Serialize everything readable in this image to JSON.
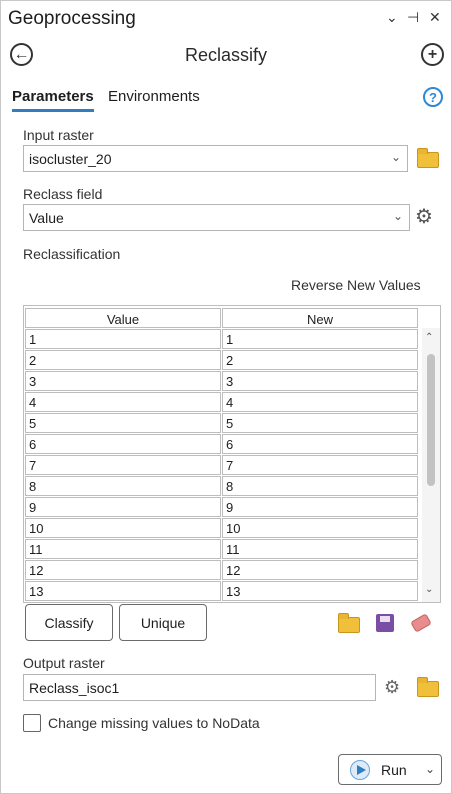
{
  "window": {
    "title": "Geoprocessing",
    "controls": {
      "menu": "⌄",
      "pin": "⊣",
      "close": "✕"
    }
  },
  "header": {
    "tool_name": "Reclassify",
    "back_icon": "←",
    "add_icon": "+"
  },
  "tabs": [
    {
      "label": "Parameters",
      "active": true
    },
    {
      "label": "Environments",
      "active": false
    }
  ],
  "help_icon": "?",
  "input_raster": {
    "label": "Input raster",
    "value": "isocluster_20"
  },
  "reclass_field": {
    "label": "Reclass field",
    "value": "Value"
  },
  "reclassification": {
    "label": "Reclassification",
    "reverse_link": "Reverse New Values",
    "columns": [
      "Value",
      "New"
    ],
    "rows": [
      [
        "1",
        "1"
      ],
      [
        "2",
        "2"
      ],
      [
        "3",
        "3"
      ],
      [
        "4",
        "4"
      ],
      [
        "5",
        "5"
      ],
      [
        "6",
        "6"
      ],
      [
        "7",
        "7"
      ],
      [
        "8",
        "8"
      ],
      [
        "9",
        "9"
      ],
      [
        "10",
        "10"
      ],
      [
        "11",
        "11"
      ],
      [
        "12",
        "12"
      ],
      [
        "13",
        "13"
      ]
    ],
    "scroll_up": "⌃",
    "scroll_down": "⌄"
  },
  "buttons": {
    "classify": "Classify",
    "unique": "Unique"
  },
  "output_raster": {
    "label": "Output raster",
    "value": "Reclass_isoc1"
  },
  "missing_values": {
    "label": "Change missing values to NoData",
    "checked": false
  },
  "run": {
    "label": "Run",
    "chevron": "⌄"
  },
  "colors": {
    "accent": "#2e7ec0",
    "folder": "#f0c03a",
    "save": "#7a4fa3",
    "eraser": "#e98c8c"
  }
}
